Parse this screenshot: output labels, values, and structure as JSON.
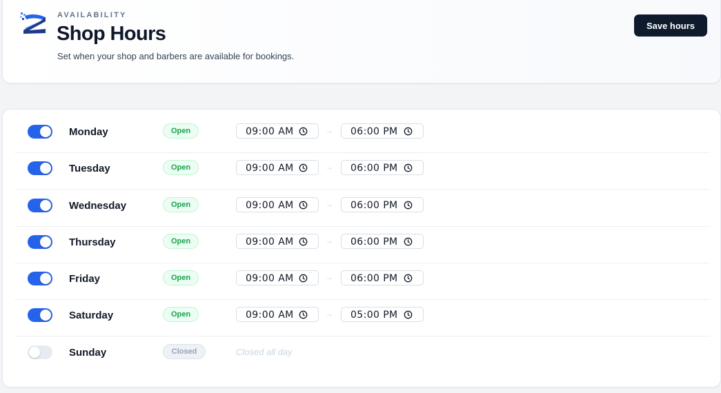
{
  "header": {
    "eyebrow": "AVAILABILITY",
    "title": "Shop Hours",
    "subtitle": "Set when your shop and barbers are available for bookings.",
    "logo_icon": "brand-logo",
    "save_label": "Save hours"
  },
  "colors": {
    "accent": "#2563eb",
    "primary_button": "#0f1b2d",
    "open_badge_text": "#16a34a",
    "closed_badge_text": "#94a3b8"
  },
  "days": [
    {
      "name": "Monday",
      "enabled": true,
      "status": "Open",
      "open_time": "09:00 AM",
      "close_time": "06:00 PM"
    },
    {
      "name": "Tuesday",
      "enabled": true,
      "status": "Open",
      "open_time": "09:00 AM",
      "close_time": "06:00 PM"
    },
    {
      "name": "Wednesday",
      "enabled": true,
      "status": "Open",
      "open_time": "09:00 AM",
      "close_time": "06:00 PM"
    },
    {
      "name": "Thursday",
      "enabled": true,
      "status": "Open",
      "open_time": "09:00 AM",
      "close_time": "06:00 PM"
    },
    {
      "name": "Friday",
      "enabled": true,
      "status": "Open",
      "open_time": "09:00 AM",
      "close_time": "06:00 PM"
    },
    {
      "name": "Saturday",
      "enabled": true,
      "status": "Open",
      "open_time": "09:00 AM",
      "close_time": "05:00 PM"
    },
    {
      "name": "Sunday",
      "enabled": false,
      "status": "Closed",
      "closed_note": "Closed all day"
    }
  ],
  "separator": "→",
  "icons": {
    "time_input": "clock-icon",
    "toggle": "toggle-switch"
  }
}
